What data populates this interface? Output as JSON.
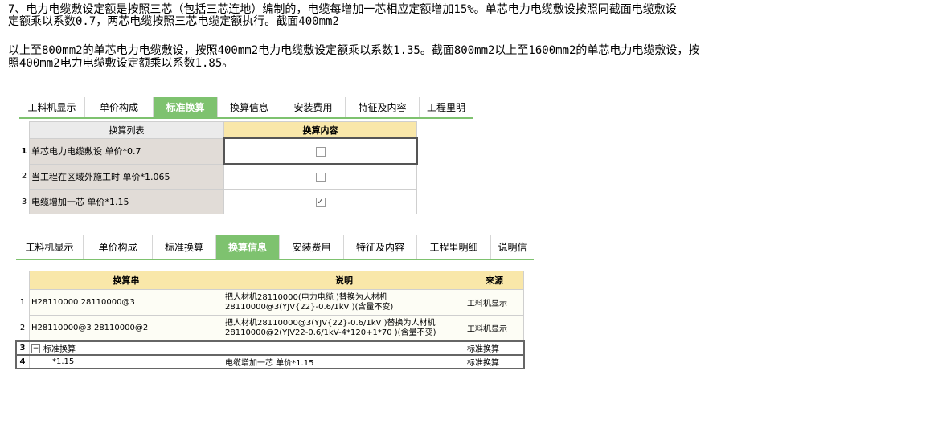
{
  "paragraph1": {
    "line1": "7、电力电缆敷设定额是按照三芯（包括三芯连地）编制的，电缆每增加一芯相应定额增加15%。单芯电力电缆敷设按照同截面电缆敷设",
    "line2": "定额乘以系数0.7，两芯电缆按照三芯电缆定额执行。截面400mm2"
  },
  "paragraph2": {
    "line1": "以上至800mm2的单芯电力电缆敷设，按照400mm2电力电缆敷设定额乘以系数1.35。截面800mm2以上至1600mm2的单芯电力电缆敷设，按",
    "line2": "照400mm2电力电缆敷设定额乘以系数1.85。"
  },
  "tabs1": [
    {
      "label": "工料机显示"
    },
    {
      "label": "单价构成"
    },
    {
      "label": "标准换算"
    },
    {
      "label": "换算信息"
    },
    {
      "label": "安装费用"
    },
    {
      "label": "特征及内容"
    },
    {
      "label": "工程里明"
    }
  ],
  "table1": {
    "headers": [
      "换算列表",
      "换算内容"
    ],
    "rows": [
      {
        "num": "1",
        "name": "单芯电力电缆敷设 单价*0.7",
        "checked": false
      },
      {
        "num": "2",
        "name": "当工程在区域外施工时 单价*1.065",
        "checked": false
      },
      {
        "num": "3",
        "name": "电缆增加一芯 单价*1.15",
        "checked": true
      }
    ]
  },
  "tabs2": [
    {
      "label": "工料机显示"
    },
    {
      "label": "单价构成"
    },
    {
      "label": "标准换算"
    },
    {
      "label": "换算信息"
    },
    {
      "label": "安装费用"
    },
    {
      "label": "特征及内容"
    },
    {
      "label": "工程里明细"
    },
    {
      "label": "说明信"
    }
  ],
  "table2": {
    "headers": [
      "换算串",
      "说明",
      "来源"
    ],
    "rows": [
      {
        "num": "1",
        "code": "H28110000 28110000@3",
        "desc1": "把人材机28110000(电力电缆 )替换为人材机",
        "desc2": "28110000@3(YJV{22}-0.6/1kV )(含量不变)",
        "source": "工料机显示"
      },
      {
        "num": "2",
        "code": "H28110000@3 28110000@2",
        "desc1": "把人材机28110000@3(YJV{22}-0.6/1kV )替换为人材机",
        "desc2": "28110000@2(YJV22-0.6/1kV-4*120+1*70 )(含量不变)",
        "source": "工料机显示"
      },
      {
        "num": "3",
        "code": "标准换算",
        "desc": "",
        "source": "标准换算"
      },
      {
        "num": "4",
        "code": "*1.15",
        "desc": "电缆增加一芯 单价*1.15",
        "source": "标准换算"
      }
    ]
  }
}
